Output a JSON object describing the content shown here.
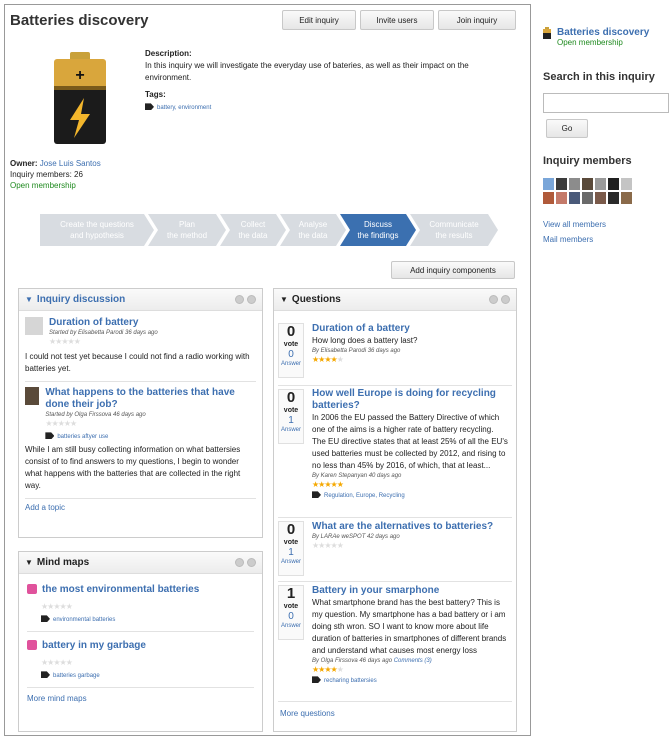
{
  "header": {
    "title": "Batteries discovery",
    "buttons": [
      "Edit inquiry",
      "Invite users",
      "Join inquiry"
    ]
  },
  "info": {
    "desc_label": "Description:",
    "description": "In this inquiry we will investigate the everyday use of bateries, as well as their impact on the environment.",
    "tags_label": "Tags:",
    "tags": "battery, environment",
    "owner_label": "Owner:",
    "owner": "Jose Luis Santos",
    "members": "Inquiry members: 26",
    "membership": "Open membership"
  },
  "steps": [
    {
      "line1": "Create the questions",
      "line2": "and hypothesis"
    },
    {
      "line1": "Plan",
      "line2": "the method"
    },
    {
      "line1": "Collect",
      "line2": "the data"
    },
    {
      "line1": "Analyse",
      "line2": "the data"
    },
    {
      "line1": "Discuss",
      "line2": "the findings"
    },
    {
      "line1": "Communicate",
      "line2": "the results"
    }
  ],
  "add_components": "Add inquiry components",
  "discussion": {
    "title": "Inquiry discussion",
    "topics": [
      {
        "title": "Duration of battery",
        "meta": "Started by Elisabetta Parodi 36 days ago",
        "text": "I could not test yet because I could not find a radio working with batteries yet."
      },
      {
        "title": "What happens to the batteries that have done their job?",
        "meta": "Started by Olga Firssova 46 days ago",
        "tag": "batteries aftyer use",
        "text": "While I am still busy collecting information on what battersies consist of to find answers to my questions, I begin to wonder what happens with the batteries that are collected in the right way."
      }
    ],
    "add_topic": "Add a topic"
  },
  "mindmaps": {
    "title": "Mind maps",
    "items": [
      {
        "title": "the most environmental batteries",
        "tag": "environmental batteries"
      },
      {
        "title": "battery in my garbage",
        "tag": "batteries garbage"
      }
    ],
    "more": "More mind maps"
  },
  "questions": {
    "title": "Questions",
    "vote_label": "vote",
    "answer_label": "Answer",
    "items": [
      {
        "votes": "0",
        "answers": "0",
        "title": "Duration of a battery",
        "text": "How long does a battery last?",
        "meta": "By Elisabetta Parodi 36 days ago",
        "rating": 4
      },
      {
        "votes": "0",
        "answers": "1",
        "title": "How well Europe is doing for recycling batteries?",
        "text": "In 2006 the EU passed the Battery Directive of which one of the aims is a higher rate of battery recycling. The EU directive states that at least 25% of all the EU's used batteries must be collected by 2012, and rising to no less than 45% by 2016, of which, that at least...",
        "meta": "By Karen Stepanyan 40 days ago",
        "rating": 5,
        "tags": "Regulation, Europe, Recycling"
      },
      {
        "votes": "0",
        "answers": "1",
        "title": "What are the alternatives to batteries?",
        "text": "",
        "meta": "By LARAe weSPOT 42 days ago",
        "rating": 0
      },
      {
        "votes": "1",
        "answers": "0",
        "title": "Battery in your smarphone",
        "text": "What smartphone brand has the best battery? This is my question. My smartphone has a bad battery or i am doing sth wron. SO I want to know more about life duration of batteries in smartphones of different brands and understand what causes most energy loss",
        "meta": "By Olga Firssova 46 days ago",
        "comments": "Comments (3)",
        "rating": 4,
        "tags": "recharing battersies"
      }
    ],
    "more": "More questions"
  },
  "sidebar": {
    "title": "Batteries discovery",
    "membership": "Open membership",
    "search_title": "Search in this inquiry",
    "search_placeholder": "",
    "go": "Go",
    "members_title": "Inquiry members",
    "view_all": "View all members",
    "mail": "Mail members"
  },
  "colors": {
    "accent": "#3b70b0",
    "step": "#d8dce1",
    "star": "#f5a800",
    "mindmap": "#e0529c"
  }
}
